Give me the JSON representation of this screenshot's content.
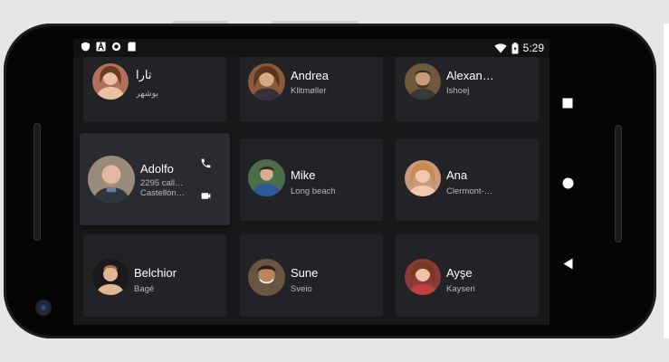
{
  "status_bar": {
    "time": "5:29",
    "left_icons": [
      "shield-icon",
      "font-a-icon",
      "circle-icon",
      "sd-card-icon"
    ],
    "right_icons": [
      "wifi-icon",
      "battery-icon"
    ]
  },
  "contacts": [
    {
      "name": "تارا",
      "line1": "بوشهر",
      "line2": "",
      "avatar_bg": "#b0705a",
      "focused": false
    },
    {
      "name": "Andrea",
      "line1": "Klitmøller",
      "line2": "",
      "avatar_bg": "#8a5b3a",
      "focused": false
    },
    {
      "name": "Alexan…",
      "line1": "Ishoej",
      "line2": "",
      "avatar_bg": "#6e5a3b",
      "focused": false
    },
    {
      "name": "Adolfo",
      "line1": "2295 call…",
      "line2": "Castellón…",
      "avatar_bg": "#9a8a7a",
      "focused": true
    },
    {
      "name": "Mike",
      "line1": "Long beach",
      "line2": "",
      "avatar_bg": "#41608a",
      "focused": false
    },
    {
      "name": "Ana",
      "line1": "Clermont-…",
      "line2": "",
      "avatar_bg": "#c79a7e",
      "focused": false
    },
    {
      "name": "Belchior",
      "line1": "Bagé",
      "line2": "",
      "avatar_bg": "#7b6a58",
      "focused": false
    },
    {
      "name": "Sune",
      "line1": "Sveio",
      "line2": "",
      "avatar_bg": "#6a5540",
      "focused": false
    },
    {
      "name": "Ayşe",
      "line1": "Kayseri",
      "line2": "",
      "avatar_bg": "#8a3a3a",
      "focused": false
    }
  ],
  "focused_actions": [
    "phone-icon",
    "videocam-icon"
  ],
  "nav_buttons": [
    "overview-square-icon",
    "home-circle-icon",
    "back-triangle-icon"
  ]
}
